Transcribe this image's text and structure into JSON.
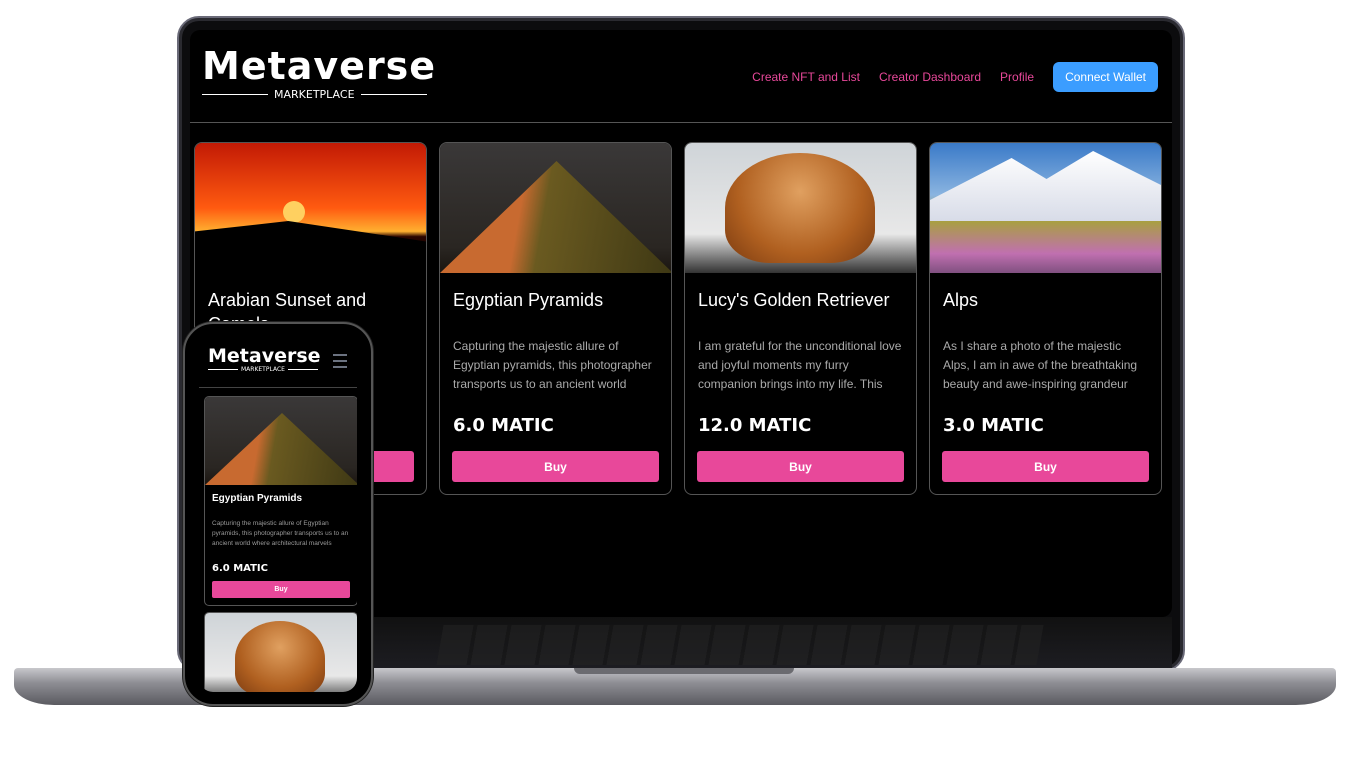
{
  "app": {
    "logo_main": "Metaverse",
    "logo_sub": "MARKETPLACE"
  },
  "nav": {
    "items": [
      "Create NFT and List",
      "Creator Dashboard",
      "Profile"
    ],
    "connect_label": "Connect Wallet"
  },
  "colors": {
    "accent": "#e8489a",
    "connect": "#3b9dff",
    "background": "#000000"
  },
  "cards": [
    {
      "title": "Arabian Sunset and Camels",
      "description": "",
      "price": "",
      "buy": "Buy"
    },
    {
      "title": "Egyptian Pyramids",
      "description": "Capturing the majestic allure of Egyptian pyramids, this photographer transports us to an ancient world",
      "price": "6.0 MATIC",
      "buy": "Buy"
    },
    {
      "title": "Lucy's Golden Retriever",
      "description": "I am grateful for the unconditional love and joyful moments my furry companion brings into my life. This",
      "price": "12.0 MATIC",
      "buy": "Buy"
    },
    {
      "title": "Alps",
      "description": "As I share a photo of the majestic Alps, I am in awe of the breathtaking beauty and awe-inspiring grandeur",
      "price": "3.0 MATIC",
      "buy": "Buy"
    }
  ],
  "phone": {
    "menu_icon": "hamburger-icon",
    "card": {
      "title": "Egyptian Pyramids",
      "description": "Capturing the majestic allure of Egyptian pyramids, this photographer transports us to an ancient world where architectural marvels",
      "price": "6.0 MATIC",
      "buy": "Buy"
    }
  }
}
